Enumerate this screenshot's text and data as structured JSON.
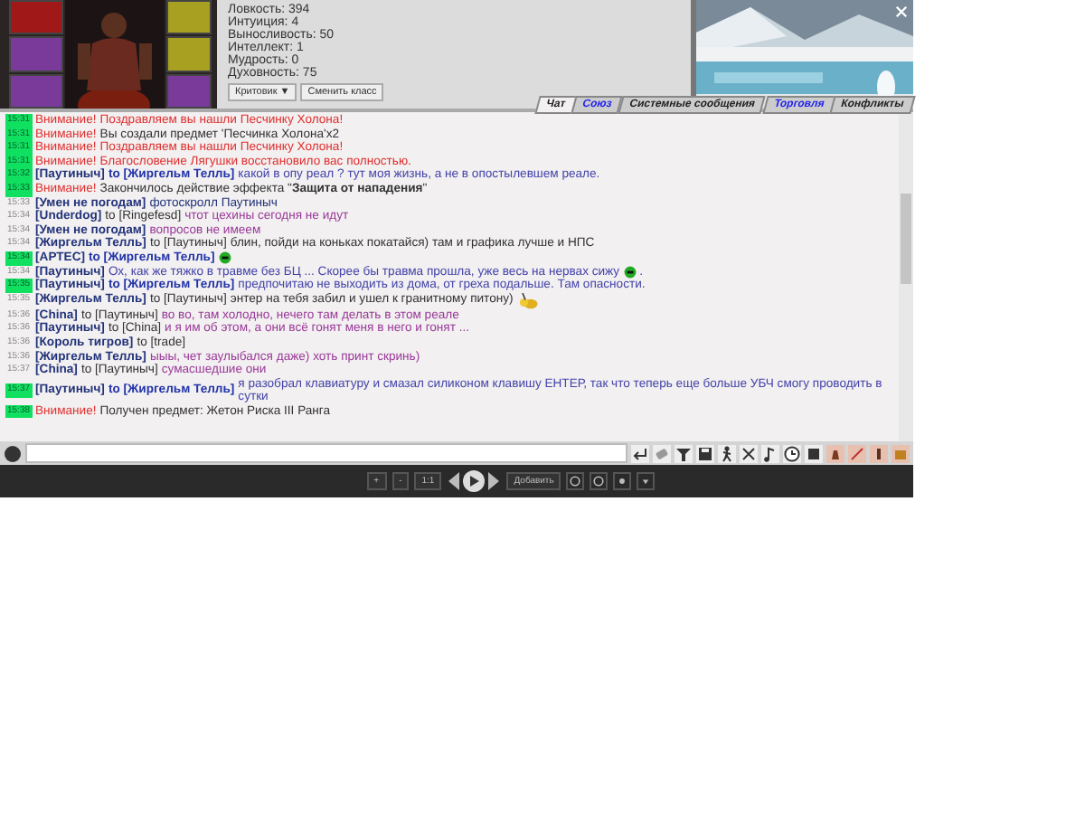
{
  "stats": [
    {
      "label": "Ловкость:",
      "value": "394"
    },
    {
      "label": "Интуиция:",
      "value": "4"
    },
    {
      "label": "Выносливость:",
      "value": "50"
    },
    {
      "label": "Интеллект:",
      "value": "1"
    },
    {
      "label": "Мудрость:",
      "value": "0"
    },
    {
      "label": "Духовность:",
      "value": "75"
    }
  ],
  "class_select": {
    "value": "Критовик",
    "arrow": "▼"
  },
  "change_class_button": "Сменить класс",
  "tabs": [
    {
      "label": "Чат",
      "selected": true,
      "color": "#222222"
    },
    {
      "label": "Союз",
      "selected": false,
      "color": "#2222ee"
    },
    {
      "label": "Системные сообщения",
      "selected": false,
      "color": "#222222"
    },
    {
      "label": "Торговля",
      "selected": false,
      "color": "#2222ee"
    },
    {
      "label": "Конфликты",
      "selected": false,
      "color": "#222222"
    }
  ],
  "messages": [
    {
      "kind": "alert",
      "time": "15:31",
      "highlight": true,
      "label": "Внимание!",
      "text": "Поздравляем вы нашли Песчинку Холона!",
      "color": "#e03030"
    },
    {
      "kind": "alert",
      "time": "15:31",
      "highlight": true,
      "label": "Внимание!",
      "text": "Вы создали предмет 'Песчинка Холона'x2",
      "color": "#333333"
    },
    {
      "kind": "alert",
      "time": "15:31",
      "highlight": true,
      "label": "Внимание!",
      "text": "Поздравляем вы нашли Песчинку Холона!",
      "color": "#e03030"
    },
    {
      "kind": "alert",
      "time": "15:31",
      "highlight": true,
      "label": "Внимание!",
      "text": "Благословение Лягушки восстановило вас полностью.",
      "color": "#e03030"
    },
    {
      "kind": "chat",
      "time": "15:32",
      "highlight": true,
      "sender": "[Паутиныч]",
      "recipient": "to [Жиргельм Телль]",
      "to_me": true,
      "text": "какой в опу реал ? тут моя жизнь, а не в опостылевшем реале.",
      "color": "#4444aa"
    },
    {
      "kind": "alert",
      "time": "15:33",
      "highlight": true,
      "label": "Внимание!",
      "text": "Закончилось действие эффекта \"**Защита от нападения**\"",
      "color": "#333333"
    },
    {
      "kind": "chat",
      "time": "15:33",
      "highlight": false,
      "sender": "[Умен не погодам]",
      "text": "фотоскролл Паутиныч",
      "color": "#22337a"
    },
    {
      "kind": "chat",
      "time": "15:34",
      "highlight": false,
      "sender": "[Underdog]",
      "recipient": "to [Ringefesd]",
      "to_me": false,
      "text": "чтот цехины сегодня не идут",
      "color": "#9a3a9a"
    },
    {
      "kind": "chat",
      "time": "15:34",
      "highlight": false,
      "sender": "[Умен не погодам]",
      "text": "вопросов не имеем",
      "color": "#9a3a9a"
    },
    {
      "kind": "chat",
      "time": "15:34",
      "highlight": false,
      "sender": "[Жиргельм Телль]",
      "recipient": "to [Паутиныч]",
      "to_me": false,
      "text": "блин, пойди на коньках покатайся) там и графика лучше и НПС",
      "color": "#333333"
    },
    {
      "kind": "chat",
      "time": "15:34",
      "highlight": true,
      "sender": "[АРТЕС]",
      "recipient": "to [Жиргельм Телль]",
      "to_me": true,
      "emote": {
        "kind": "smiley"
      }
    },
    {
      "kind": "chat",
      "time": "15:34",
      "highlight": false,
      "sender": "[Паутиныч]",
      "text": "Ох, как же тяжко в травме без БЦ ... Скорее бы травма прошла, уже весь на нервах сижу",
      "emote": {
        "kind": "smiley"
      },
      "after": ".",
      "color": "#4444aa"
    },
    {
      "kind": "chat",
      "time": "15:35",
      "highlight": true,
      "sender": "[Паутиныч]",
      "recipient": "to [Жиргельм Телль]",
      "to_me": true,
      "text": "предпочитаю не выходить из дома, от греха подальше. Там опасности.",
      "color": "#4444aa"
    },
    {
      "kind": "chat",
      "time": "15:35",
      "highlight": false,
      "sender": "[Жиргельм Телль]",
      "recipient": "to [Паутиныч]",
      "to_me": false,
      "text": "энтер на тебя забил и ушел к гранитному питону)",
      "emote": {
        "kind": "creature"
      },
      "color": "#333333"
    },
    {
      "kind": "chat",
      "time": "15:36",
      "highlight": false,
      "sender": "[China]",
      "recipient": "to [Паутиныч]",
      "to_me": false,
      "text": "во во, там холодно, нечего там делать в этом реале",
      "color": "#9a3a9a"
    },
    {
      "kind": "chat",
      "time": "15:36",
      "highlight": false,
      "sender": "[Паутиныч]",
      "recipient": "to [China]",
      "to_me": false,
      "text": "и я им об этом, а они всё гонят меня в него и гонят ...",
      "color": "#9a3a9a"
    },
    {
      "kind": "chat",
      "time": "15:36",
      "highlight": false,
      "sender": "[Король тигров]",
      "recipient": "to [trade]",
      "to_me": false
    },
    {
      "kind": "chat",
      "time": "15:36",
      "highlight": false,
      "sender": "[Жиргельм Телль]",
      "text": "ыыы, чет заулыбался даже) хоть принт скринь)",
      "color": "#9a3a9a"
    },
    {
      "kind": "chat",
      "time": "15:37",
      "highlight": false,
      "sender": "[China]",
      "recipient": "to [Паутиныч]",
      "to_me": false,
      "text": "сумасшедшие они",
      "color": "#9a3a9a"
    },
    {
      "kind": "chat",
      "time": "15:37",
      "highlight": true,
      "sender": "[Паутиныч]",
      "recipient": "to [Жиргельм Телль]",
      "to_me": true,
      "text": "я разобрал клавиатуру и смазал силиконом клавишу ЕНТЕР, так что теперь еще больше УБЧ смогу проводить в сутки",
      "color": "#4444aa"
    },
    {
      "kind": "alert",
      "time": "15:38",
      "highlight": true,
      "label": "Внимание!",
      "text": "Получен предмет: Жетон Риска III Ранга",
      "color": "#333333"
    }
  ],
  "zoom_buttons": [
    "+",
    "-",
    "1:1"
  ],
  "add_button": "Добавить"
}
